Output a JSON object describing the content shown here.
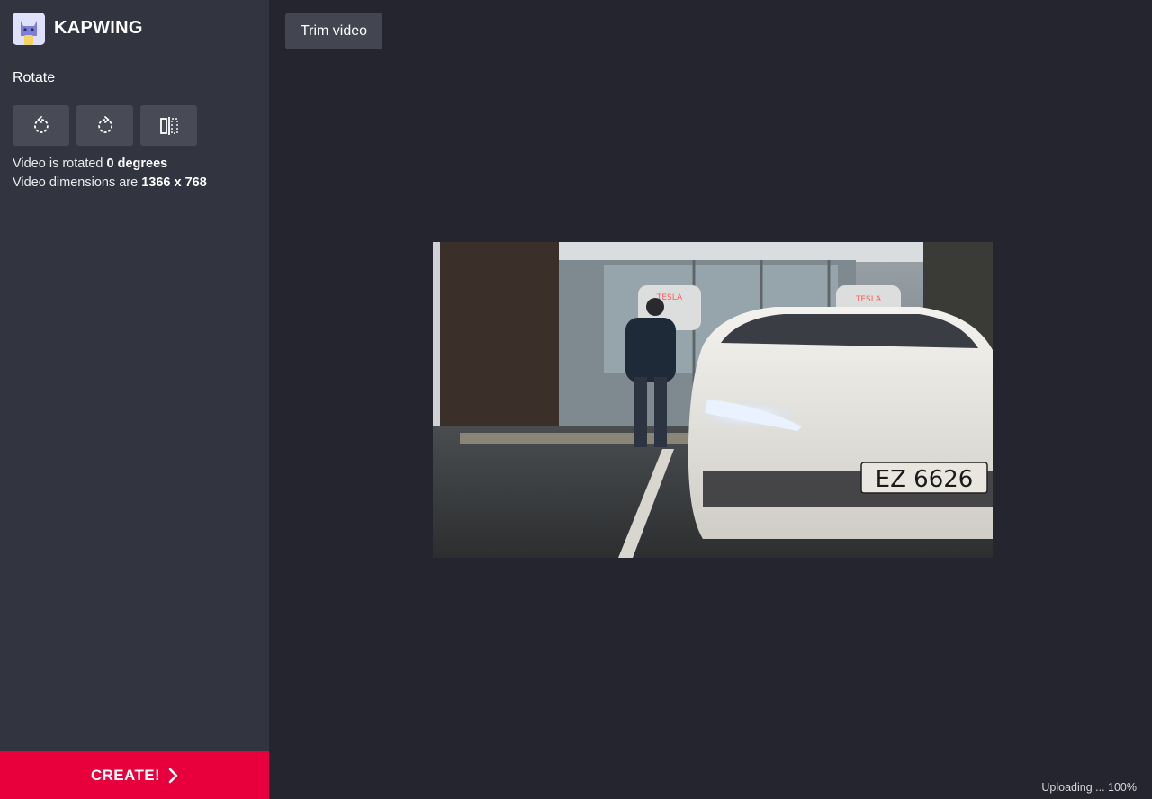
{
  "brand": {
    "name": "KAPWING",
    "logo_icon": "kapwing-cat-logo"
  },
  "sidebar": {
    "section_title": "Rotate",
    "buttons": [
      {
        "icon": "rotate-left-icon"
      },
      {
        "icon": "rotate-right-icon"
      },
      {
        "icon": "flip-horizontal-icon"
      }
    ],
    "rotation_prefix": "Video is rotated",
    "rotation_value": "0 degrees",
    "dimensions_prefix": "Video dimensions are",
    "dimensions_value": "1366 x 768"
  },
  "create_button": {
    "label": "CREATE!",
    "icon": "chevron-right-icon"
  },
  "toolbar": {
    "trim_label": "Trim video"
  },
  "video": {
    "plate_text": "EZ 6626",
    "sign_text": "TESLA"
  },
  "status": {
    "upload_text": "Uploading ... 100%"
  },
  "colors": {
    "sidebar_bg": "#323440",
    "main_bg": "#24252f",
    "accent": "#e8003d",
    "button_bg": "#484a55"
  }
}
